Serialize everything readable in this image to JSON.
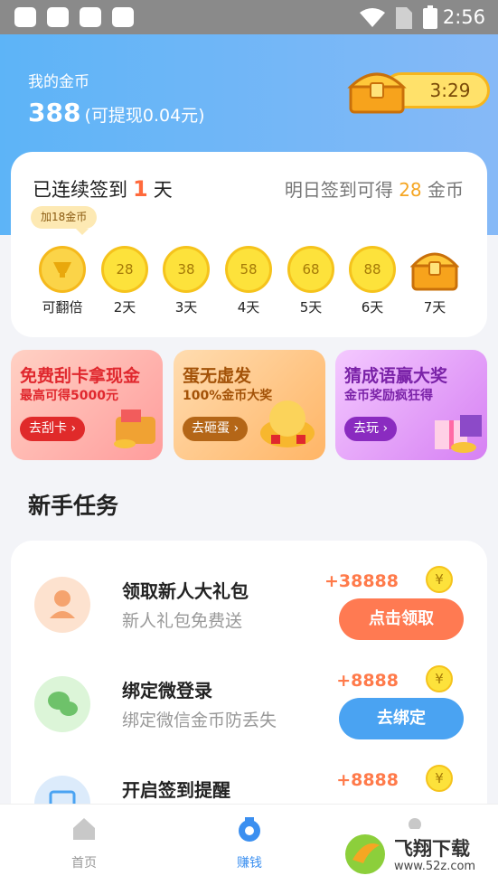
{
  "status_bar": {
    "time": "2:56"
  },
  "header": {
    "title": "我的金币",
    "coins": "388",
    "withdrawable": "(可提现0.04元)",
    "timer": "3:29"
  },
  "signin": {
    "prefix": "已连续签到",
    "days": "1",
    "suffix": "天",
    "tomorrow_prefix": "明日签到可得",
    "tomorrow_coins": "28",
    "tomorrow_suffix": "金币",
    "bubble": "加18金币",
    "days_list": [
      {
        "value": "",
        "label": "可翻倍"
      },
      {
        "value": "28",
        "label": "2天"
      },
      {
        "value": "38",
        "label": "3天"
      },
      {
        "value": "58",
        "label": "4天"
      },
      {
        "value": "68",
        "label": "5天"
      },
      {
        "value": "88",
        "label": "6天"
      },
      {
        "value": "",
        "label": "7天"
      }
    ]
  },
  "banners": [
    {
      "title": "免费刮卡拿现金",
      "subtitle": "最高可得5000元",
      "button": "去刮卡"
    },
    {
      "title": "蛋无虚发",
      "subtitle": "100%金币大奖",
      "button": "去砸蛋"
    },
    {
      "title": "猜成语赢大奖",
      "subtitle": "金币奖励疯狂得",
      "button": "去玩"
    }
  ],
  "section_title": "新手任务",
  "tasks": [
    {
      "title": "领取新人大礼包",
      "desc": "新人礼包免费送",
      "reward": "+38888",
      "button": "点击领取"
    },
    {
      "title": "绑定微登录",
      "desc": "绑定微信金币防丢失",
      "reward": "+8888",
      "button": "去绑定"
    },
    {
      "title": "开启签到提醒",
      "desc": "",
      "reward": "+8888",
      "button": ""
    }
  ],
  "nav": {
    "home": "首页",
    "earn": "赚钱"
  },
  "watermark": {
    "name": "飞翔下载",
    "url": "www.52z.com"
  }
}
